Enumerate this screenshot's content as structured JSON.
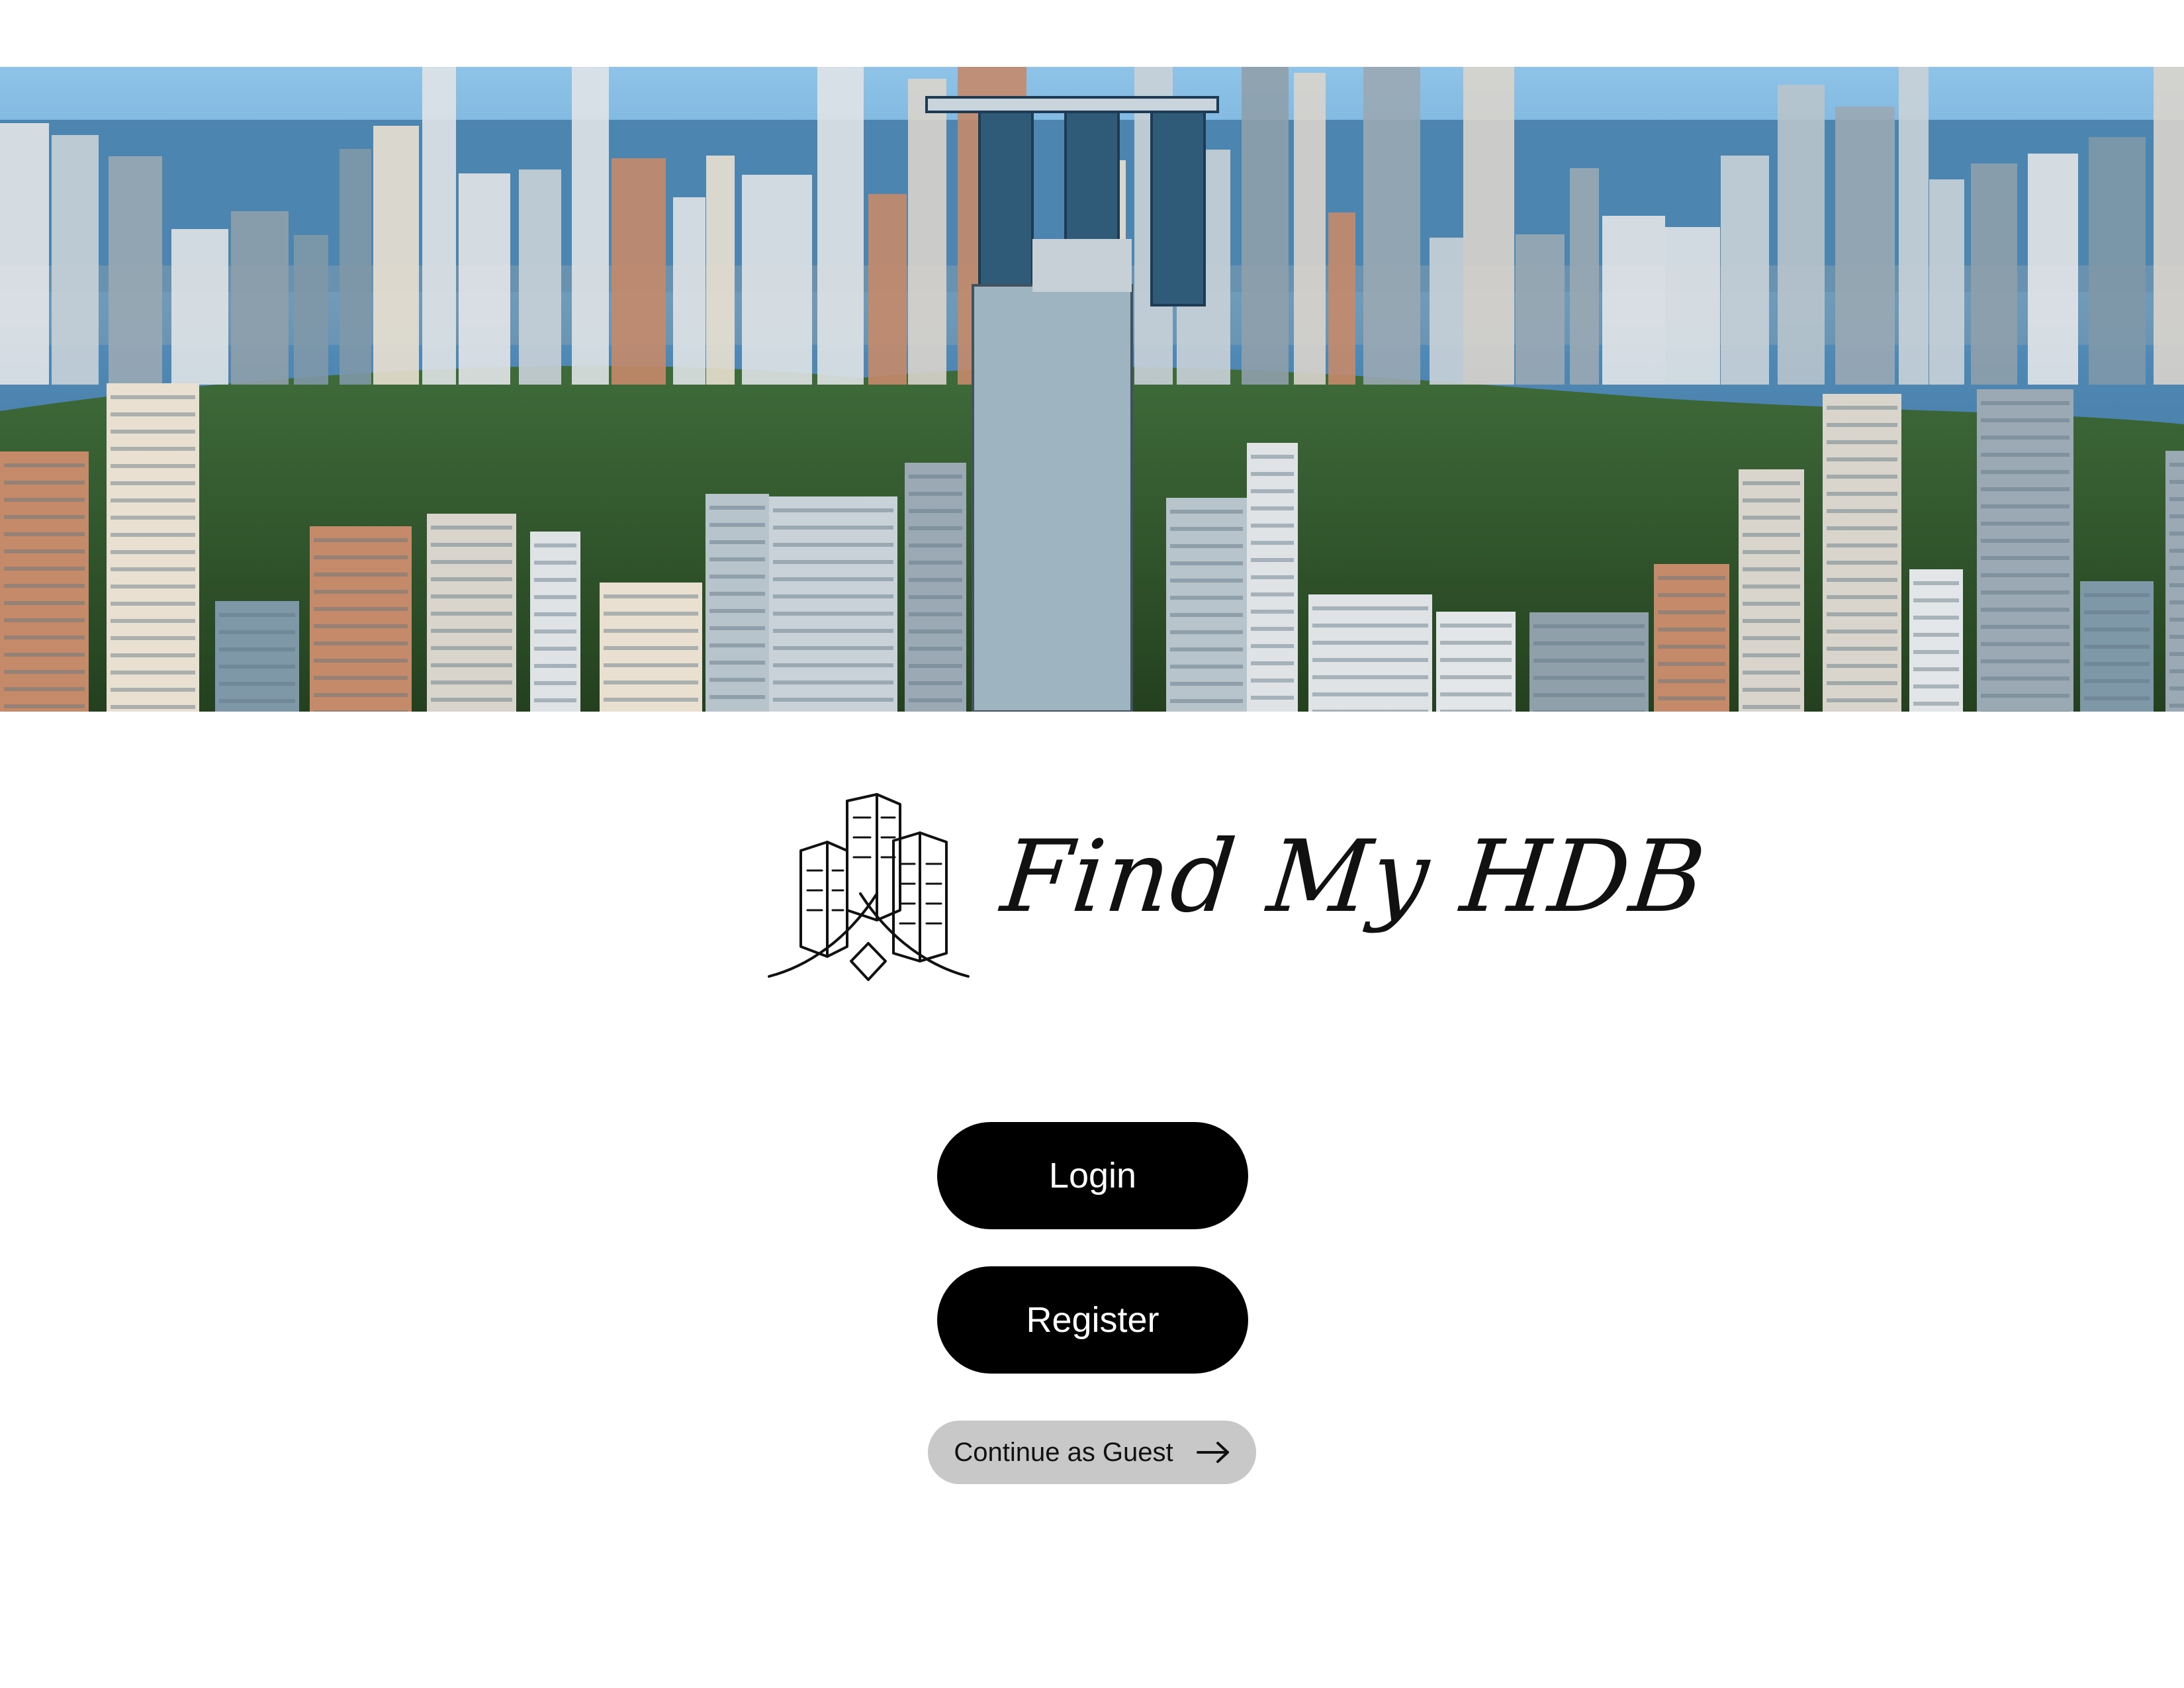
{
  "app": {
    "name": "Find My HDB"
  },
  "hero": {
    "icon": "city-skyline-image"
  },
  "logo": {
    "icon": "buildings-logo-icon",
    "text": "Find My HDB"
  },
  "actions": {
    "login_label": "Login",
    "register_label": "Register",
    "guest_label": "Continue as Guest",
    "guest_icon": "arrow-right-icon"
  },
  "colors": {
    "primary_button": "#000000",
    "primary_text": "#ffffff",
    "guest_button": "#c8c8c8",
    "background": "#ffffff"
  }
}
